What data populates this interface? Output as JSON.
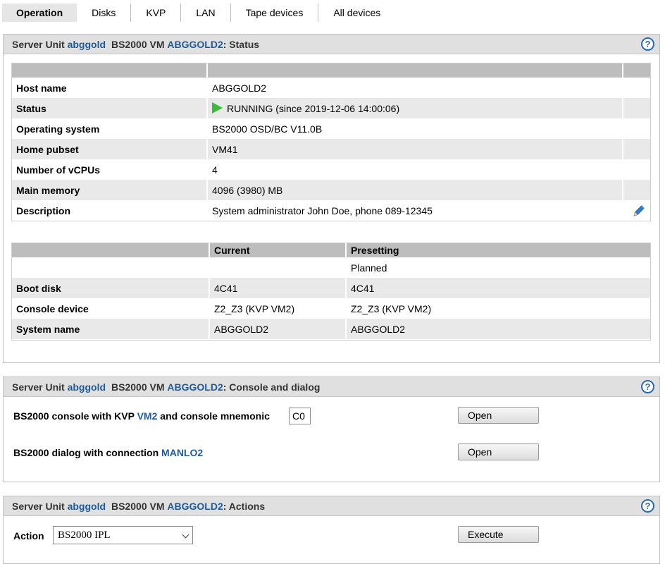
{
  "tabs": [
    "Operation",
    "Disks",
    "KVP",
    "LAN",
    "Tape devices",
    "All devices"
  ],
  "header": {
    "prefix": "Server Unit",
    "unit": "abggold",
    "vm_prefix": "BS2000 VM",
    "vm": "ABGGOLD2"
  },
  "status_panel": {
    "suffix": ": Status",
    "rows": [
      {
        "label": "Host name",
        "value": "ABGGOLD2"
      },
      {
        "label": "Status",
        "value": "RUNNING (since 2019-12-06 14:00:06)"
      },
      {
        "label": "Operating system",
        "value": "BS2000 OSD/BC V11.0B"
      },
      {
        "label": "Home pubset",
        "value": "VM41"
      },
      {
        "label": "Number of vCPUs",
        "value": "4"
      },
      {
        "label": "Main memory",
        "value": "4096 (3980) MB"
      },
      {
        "label": "Description",
        "value": "System administrator John Doe, phone 089-12345"
      }
    ],
    "config": {
      "col_current": "Current",
      "col_presetting": "Presetting",
      "planned": "Planned",
      "rows": [
        {
          "label": "Boot disk",
          "current": "4C41",
          "presetting": "4C41"
        },
        {
          "label": "Console device",
          "current": "Z2_Z3 (KVP VM2)",
          "presetting": "Z2_Z3 (KVP VM2)"
        },
        {
          "label": "System name",
          "current": "ABGGOLD2",
          "presetting": "ABGGOLD2"
        }
      ]
    }
  },
  "console_panel": {
    "suffix": ": Console and dialog",
    "console_text_a": "BS2000 console with KVP",
    "console_kvp": "VM2",
    "console_text_b": "and console mnemonic",
    "mnemonic": "C0",
    "dialog_text": "BS2000 dialog with connection",
    "dialog_conn": "MANLO2",
    "open_label": "Open"
  },
  "actions_panel": {
    "suffix": ": Actions",
    "action_label": "Action",
    "action_value": "BS2000 IPL",
    "execute_label": "Execute"
  },
  "help_glyph": "?",
  "icons": {
    "status": "play-icon",
    "edit": "pencil-icon",
    "help": "help-icon"
  },
  "colors": {
    "link": "#1f5c99",
    "running": "#3cba3c",
    "header_bg": "#e0e0e0"
  }
}
